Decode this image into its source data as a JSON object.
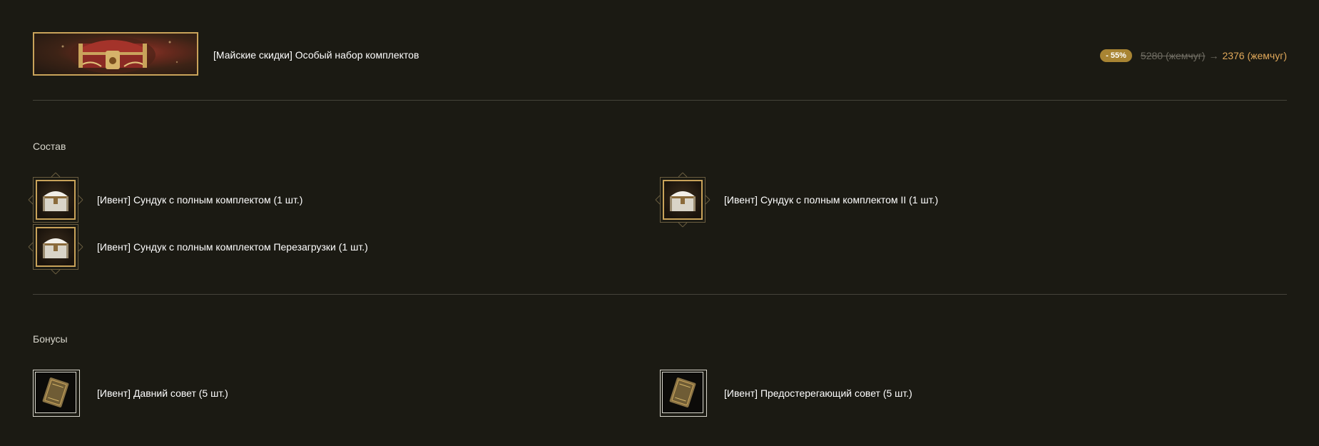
{
  "product": {
    "banner_icon": "treasure-chest-banner",
    "title": "[Майские скидки] Особый набор комплектов",
    "discount": "- 55%",
    "old_price": "5280 (жемчуг)",
    "arrow": "→",
    "new_price": "2376 (жемчуг)"
  },
  "composition": {
    "title": "Состав",
    "items": [
      {
        "icon": "chest-icon",
        "label": "[Ивент] Сундук с полным комплектом (1 шт.)"
      },
      {
        "icon": "chest-icon",
        "label": "[Ивент] Сундук с полным комплектом II (1 шт.)"
      },
      {
        "icon": "chest-icon",
        "label": "[Ивент] Сундук с полным комплектом Перезагрузки (1 шт.)"
      }
    ]
  },
  "bonuses": {
    "title": "Бонусы",
    "items": [
      {
        "icon": "scroll-card-icon",
        "label": "[Ивент] Давний совет (5 шт.)"
      },
      {
        "icon": "scroll-card-icon",
        "label": "[Ивент] Предостерегающий совет (5 шт.)"
      }
    ]
  },
  "colors": {
    "background": "#1b1a13",
    "accent_gold": "#c9a35a",
    "discount_badge": "#a88433",
    "new_price": "#e0a85a",
    "old_price": "#6f6c62"
  }
}
